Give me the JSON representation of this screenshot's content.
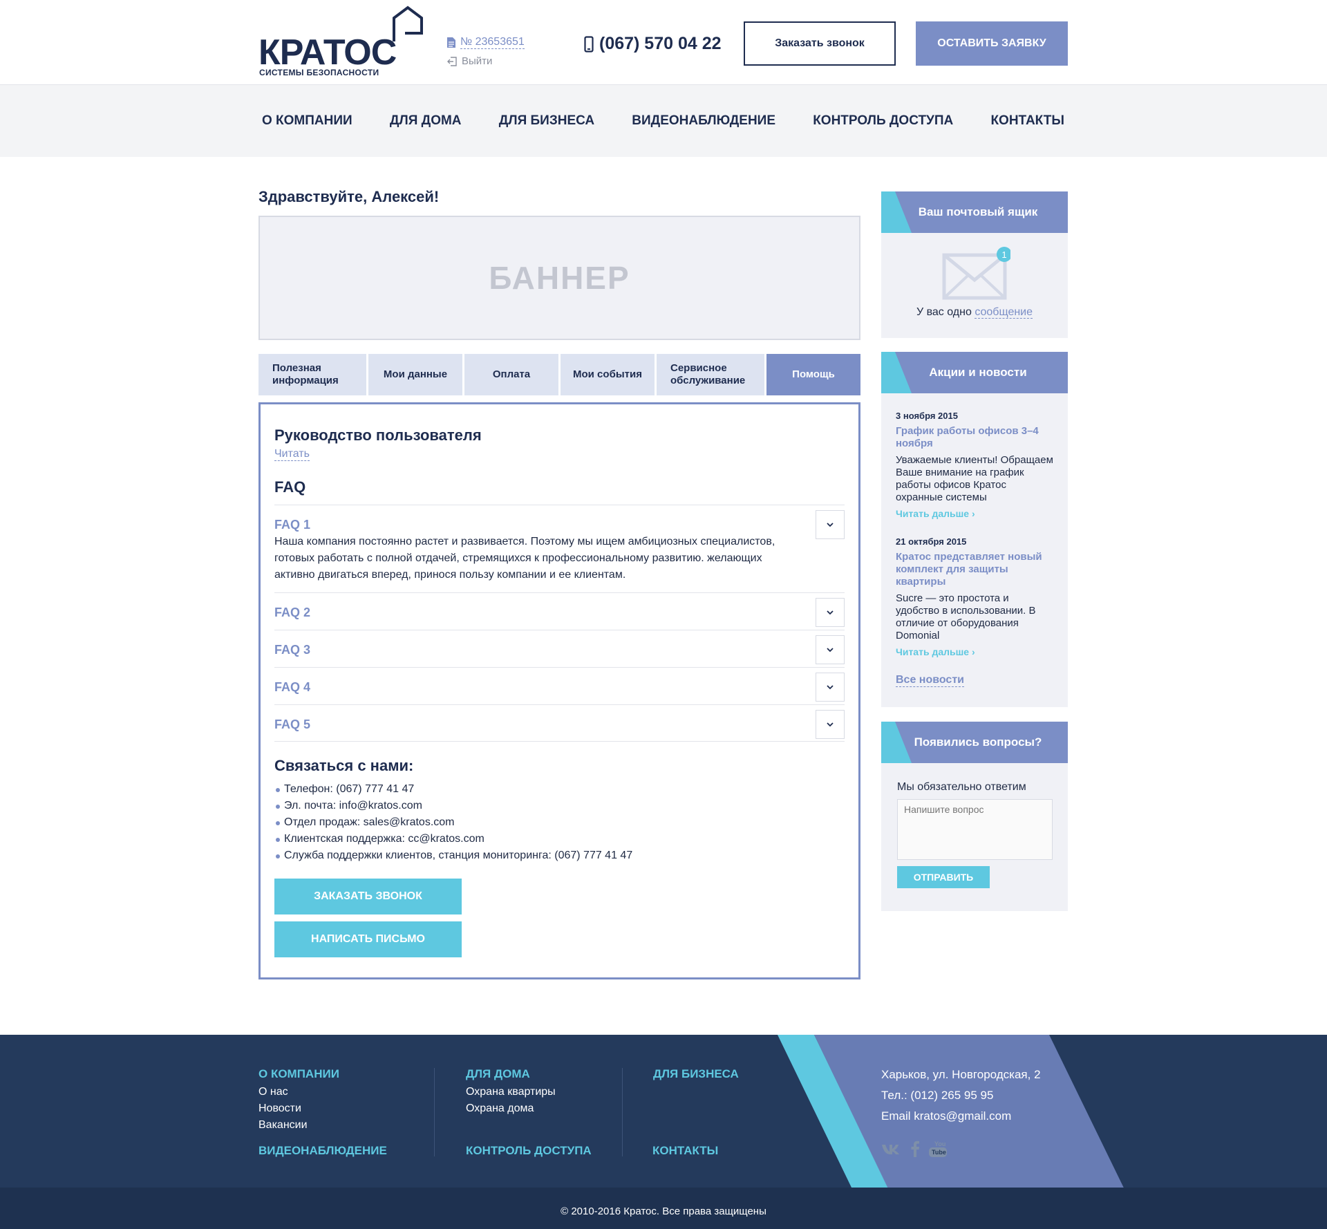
{
  "header": {
    "logo_text": "КРАТОС",
    "logo_subtitle": "СИСТЕМЫ БЕЗОПАСНОСТИ",
    "account_number": "№ 23653651",
    "logout_label": "Выйти",
    "phone": "(067) 570 04 22",
    "call_button": "Заказать звонок",
    "request_button": "ОСТАВИТЬ ЗАЯВКУ"
  },
  "nav": {
    "items": [
      "О КОМПАНИИ",
      "ДЛЯ ДОМА",
      "ДЛЯ БИЗНЕСА",
      "ВИДЕОНАБЛЮДЕНИЕ",
      "КОНТРОЛЬ ДОСТУПА",
      "КОНТАКТЫ"
    ]
  },
  "main": {
    "greeting": "Здравствуйте, Алексей!",
    "banner": "БАННЕР",
    "tabs": [
      "Полезная информация",
      "Мои данные",
      "Оплата",
      "Мои события",
      "Сервисное обслуживание",
      "Помощь"
    ],
    "active_tab": "Помощь",
    "guide_title": "Руководство пользователя",
    "guide_read": "Читать",
    "faq_title": "FAQ",
    "faq": [
      {
        "q": "FAQ 1",
        "a": "Наша компания постоянно растет и развивается. Поэтому мы ищем амбициозных специалистов, готовых работать с полной отдачей, стремящихся к профессиональному развитию. желающих активно двигаться вперед, принося пользу компании и ее клиентам."
      },
      {
        "q": "FAQ 2",
        "a": ""
      },
      {
        "q": "FAQ 3",
        "a": ""
      },
      {
        "q": "FAQ 4",
        "a": ""
      },
      {
        "q": "FAQ 5",
        "a": ""
      }
    ],
    "contact_title": "Связаться с нами:",
    "contacts": [
      "Телефон: (067) 777 41 47",
      "Эл. почта: info@kratos.com",
      "Отдел продаж: sales@kratos.com",
      "Клиентская поддержка: cc@kratos.com",
      "Служба поддержки клиентов, станция мониторинга: (067) 777 41 47"
    ],
    "order_call_button": "ЗАКАЗАТЬ ЗВОНОК",
    "write_button": "НАПИСАТЬ ПИСЬМО"
  },
  "sidebar": {
    "mail": {
      "title": "Ваш почтовый ящик",
      "badge": "1",
      "text_prefix": "У вас одно",
      "text_link": "сообщение"
    },
    "news": {
      "title": "Акции и новости",
      "items": [
        {
          "date": "3 ноября 2015",
          "title": "График работы офисов 3–4 ноября",
          "text": "Уважаемые клиенты! Обращаем Ваше внимание на график работы офисов Кратос охранные системы",
          "more": "Читать дальше"
        },
        {
          "date": "21 октября 2015",
          "title": "Кратос представляет новый комплект для защиты квартиры",
          "text": "Sucre — это простота и удобство в использовании. В отличие от оборудования Domonial",
          "more": "Читать дальше"
        }
      ],
      "all_news": "Все новости"
    },
    "questions": {
      "title": "Появились вопросы?",
      "text": "Мы обязательно ответим",
      "placeholder": "Напишите вопрос",
      "send": "ОТПРАВИТЬ"
    }
  },
  "footer": {
    "col1": {
      "head": "О КОМПАНИИ",
      "links": [
        "О нас",
        "Новости",
        "Вакансии"
      ],
      "head2": "ВИДЕОНАБЛЮДЕНИЕ"
    },
    "col2": {
      "head": "ДЛЯ ДОМА",
      "links": [
        "Охрана квартиры",
        "Охрана дома"
      ],
      "head2": "КОНТРОЛЬ ДОСТУПА"
    },
    "col3": {
      "head": "ДЛЯ БИЗНЕСА",
      "head2": "КОНТАКТЫ"
    },
    "address": "Харьков, ул. Новгородская, 2",
    "phone": "Тел.: (012) 265 95 95",
    "email": "Email  kratos@gmail.com",
    "socials": [
      "vk-icon",
      "facebook-icon",
      "youtube-icon"
    ],
    "copyright": "© 2010-2016 Кратос. Все права защищены"
  },
  "colors": {
    "brand_dark": "#1e2c4f",
    "accent": "#7b8ec6",
    "cyan": "#5ec8e0",
    "footer_bg": "#243a5c"
  }
}
